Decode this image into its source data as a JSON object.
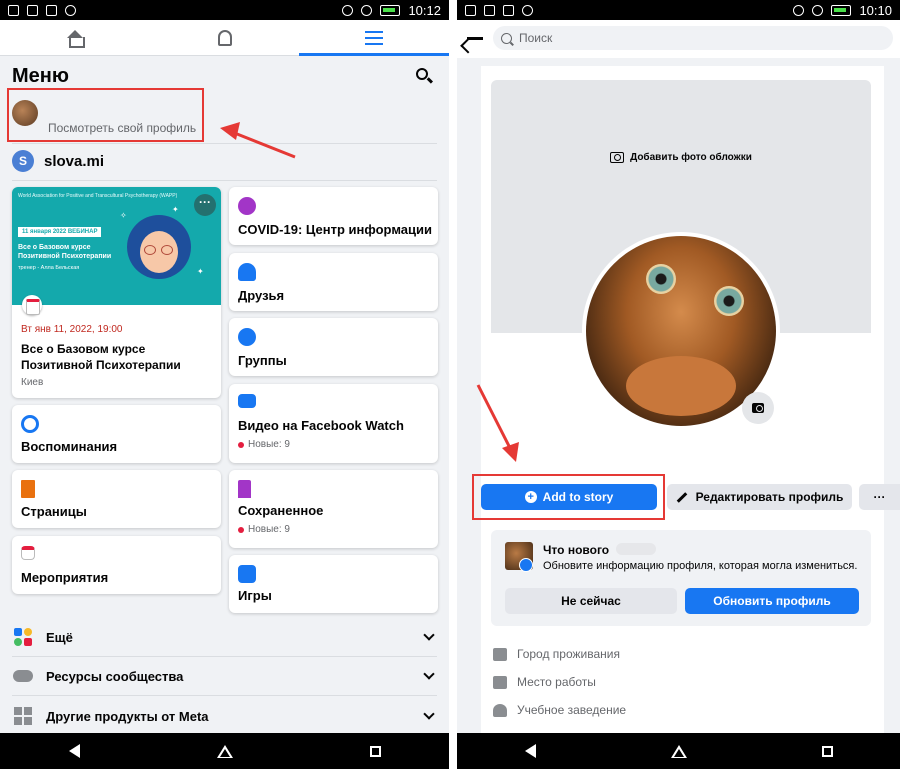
{
  "left": {
    "status": {
      "time": "10:12"
    },
    "menu_title": "Меню",
    "profile_link": "Посмотреть свой профиль",
    "page_name": "slova.mi",
    "page_initial": "S",
    "event": {
      "date": "Вт янв 11, 2022, 19:00",
      "title": "Все о Базовом курсе Позитивной Психотерапии",
      "location": "Киев",
      "image_top": "World Association for Positive and Transcultural Psychotherapy (WAPP)",
      "image_badge": "11 января 2022 ВЕБИНАР",
      "image_head": "Все о Базовом курсе Позитивной Психотерапии",
      "image_sub": "тренер - Алла Бельская"
    },
    "cards_left": [
      {
        "label": "Воспоминания",
        "icon": "clock-icon",
        "color": "#1877f2"
      },
      {
        "label": "Страницы",
        "icon": "flag-icon",
        "color": "#e9710f"
      },
      {
        "label": "Мероприятия",
        "icon": "calendar-icon",
        "color": "#e41e3f"
      }
    ],
    "cards_right": [
      {
        "label": "COVID-19: Центр информации",
        "icon": "heart-icon",
        "color": "#a235c7"
      },
      {
        "label": "Друзья",
        "icon": "friends-icon",
        "color": "#1877f2"
      },
      {
        "label": "Группы",
        "icon": "groups-icon",
        "color": "#1877f2"
      },
      {
        "label": "Видео на Facebook Watch",
        "sub": "Новые: 9",
        "icon": "video-icon",
        "color": "#1877f2"
      },
      {
        "label": "Сохраненное",
        "sub": "Новые: 9",
        "icon": "bookmark-icon",
        "color": "#a235c7"
      },
      {
        "label": "Игры",
        "icon": "games-icon",
        "color": "#1877f2"
      }
    ],
    "sections": [
      {
        "label": "Ещё"
      },
      {
        "label": "Ресурсы сообщества"
      },
      {
        "label": "Другие продукты от Meta"
      }
    ]
  },
  "right": {
    "status": {
      "time": "10:10"
    },
    "search_placeholder": "Поиск",
    "cover_label": "Добавить фото обложки",
    "add_story": "Add to story",
    "edit_profile": "Редактировать профиль",
    "more_label": "···",
    "prompt": {
      "title": "Что нового",
      "text": "Обновите информацию профиля, которая могла измениться.",
      "not_now": "Не сейчас",
      "update": "Обновить профиль"
    },
    "info": [
      {
        "label": "Город проживания",
        "icon": "home-icon"
      },
      {
        "label": "Место работы",
        "icon": "briefcase-icon"
      },
      {
        "label": "Учебное заведение",
        "icon": "graduation-cap-icon"
      }
    ]
  },
  "colors": {
    "accent": "#1877f2",
    "highlight": "#e53935",
    "background": "#f0f2f5"
  }
}
